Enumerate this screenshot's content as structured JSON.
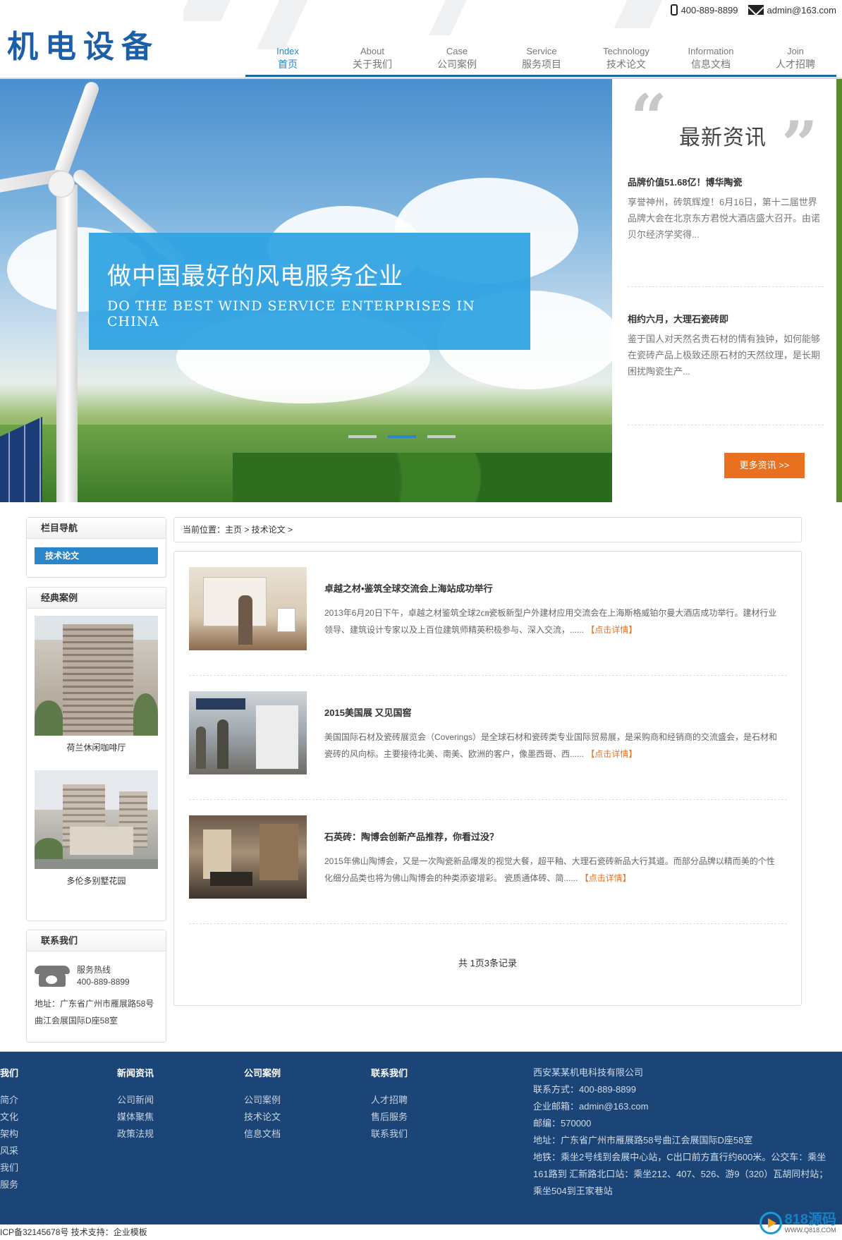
{
  "header": {
    "logo": "机电设备",
    "phone": "400-889-8899",
    "email": "admin@163.com",
    "nav": [
      {
        "en": "Index",
        "cn": "首页"
      },
      {
        "en": "About",
        "cn": "关于我们"
      },
      {
        "en": "Case",
        "cn": "公司案例"
      },
      {
        "en": "Service",
        "cn": "服务项目"
      },
      {
        "en": "Technology",
        "cn": "技术论文"
      },
      {
        "en": "Information",
        "cn": "信息文档"
      },
      {
        "en": "Join",
        "cn": "人才招聘"
      }
    ]
  },
  "banner": {
    "slogan_cn": "做中国最好的风电服务企业",
    "slogan_en": "DO THE BEST WIND SERVICE ENTERPRISES IN CHINA",
    "slide_count": 3,
    "active_slide": 2
  },
  "news": {
    "title": "最新资讯",
    "items": [
      {
        "title": "品牌价值51.68亿！博华陶瓷",
        "summary": "享誉神州，砖筑辉煌！6月16日，第十二届世界品牌大会在北京东方君悦大酒店盛大召开。由诺贝尔经济学奖得..."
      },
      {
        "title": "相约六月，大理石瓷砖即",
        "summary": "鉴于国人对天然名贵石材的情有独钟，如何能够在瓷砖产品上极致还原石材的天然纹理，是长期困扰陶瓷生产..."
      }
    ],
    "more": "更多资讯 >>"
  },
  "sidebar": {
    "nav_title": "栏目导航",
    "nav_active": "技术论文",
    "cases_title": "经典案例",
    "cases": [
      {
        "caption": "荷兰休闲咖啡厅"
      },
      {
        "caption": "多伦多别墅花园"
      }
    ],
    "contact_title": "联系我们",
    "hotline_label": "服务热线",
    "hotline": "400-889-8899",
    "address": "地址：广东省广州市雁展路58号曲江会展国际D座58室"
  },
  "breadcrumb": "当前位置：主页 > 技术论文 >",
  "articles": [
    {
      "title": "卓越之材•鉴筑全球交流会上海站成功举行",
      "summary": "2013年6月20日下午，卓越之材鉴筑全球2㎝瓷板新型户外建材应用交流会在上海斯格威铂尔曼大酒店成功举行。建材行业领导、建筑设计专家以及上百位建筑师精英积极参与、深入交流，......",
      "link": "【点击详情】"
    },
    {
      "title": "2015美国展 又见国窖",
      "summary": "美国国际石材及瓷砖展览会（Coverings）是全球石材和瓷砖类专业国际贸易展，是采购商和经销商的交流盛会，是石材和瓷砖的风向标。主要接待北美、南美、欧洲的客户，像墨西哥、西......",
      "link": "【点击详情】"
    },
    {
      "title": "石英砖：陶博会创新产品推荐，你看过没？",
      "summary": "2015年佛山陶博会，又是一次陶瓷新品爆发的视觉大餐，超平釉、大理石瓷砖新品大行其道。而部分品牌以精而美的个性化细分品类也将为佛山陶博会的种类添姿增彩。 瓷质通体砖、简......",
      "link": "【点击详情】"
    }
  ],
  "pager": "共 1页3条记录",
  "footer": {
    "columns": [
      {
        "title": "关于我们",
        "links": [
          "公司简介",
          "企业文化",
          "组织架构",
          "企业风采",
          "联系我们",
          "售后服务"
        ]
      },
      {
        "title": "新闻资讯",
        "links": [
          "公司新闻",
          "媒体聚焦",
          "政策法规"
        ]
      },
      {
        "title": "公司案例",
        "links": [
          "公司案例",
          "技术论文",
          "信息文档"
        ]
      },
      {
        "title": "联系我们",
        "links": [
          "人才招聘",
          "售后服务",
          "联系我们"
        ]
      }
    ],
    "company": "西安某某机电科技有限公司",
    "contact": "联系方式：400-889-8899",
    "email": "企业邮箱：admin@163.com",
    "zip": "邮编：570000",
    "address": "地址：广东省广州市雁展路58号曲江会展国际D座58室",
    "transit": "地铁：乘坐2号线到会展中心站，C出口前方直行约600米。公交车：乘坐161路到 汇新路北口站：乘坐212、407、526、游9（320）瓦胡同村站；乘坐504到王家巷站"
  },
  "copyright": "ICP备32145678号 技术支持：企业模板",
  "watermark": {
    "title": "818源码",
    "url": "WWW.Q818.COM"
  },
  "colors": {
    "accent": "#2a86c8",
    "orange": "#e8701e",
    "footer": "#1b4576"
  }
}
